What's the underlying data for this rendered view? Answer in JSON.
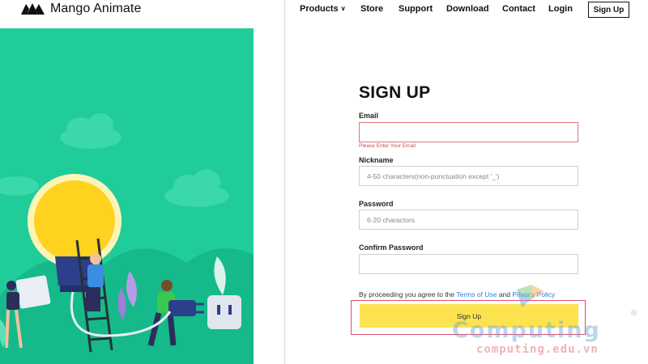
{
  "header": {
    "brand": "Mango Animate",
    "nav": [
      {
        "label": "Products",
        "has_dropdown": true
      },
      {
        "label": "Store"
      },
      {
        "label": "Support"
      },
      {
        "label": "Download"
      },
      {
        "label": "Contact"
      },
      {
        "label": "Login"
      }
    ],
    "signup_label": "Sign Up"
  },
  "form": {
    "title": "SIGN UP",
    "email": {
      "label": "Email",
      "value": "",
      "error": "Please Enter Your Email"
    },
    "nickname": {
      "label": "Nickname",
      "placeholder": "4-50 characters(non-punctuation except '_')"
    },
    "password": {
      "label": "Password",
      "placeholder": "6-20 charactors"
    },
    "confirm_password": {
      "label": "Confirm Password",
      "placeholder": ""
    },
    "terms": {
      "prefix": "By proceeding you agree to the",
      "terms_link": "Terms of Use",
      "and": "and",
      "privacy_link": "Privacy Policy"
    },
    "submit_label": "Sign Up"
  },
  "watermark": {
    "main": "Computing",
    "sub": "computing.edu.vn",
    "registered": "®"
  },
  "colors": {
    "illustration_bg": "#20cc9a",
    "submit_bg": "#fde34f",
    "error": "#d34a4a",
    "link": "#2a7fd4",
    "highlight_frame": "#e04d6a"
  }
}
